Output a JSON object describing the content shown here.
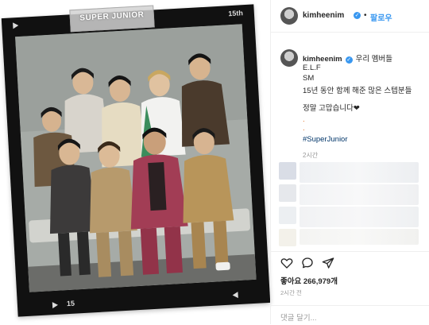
{
  "photo": {
    "tape_text": "SUPER JUNIOR",
    "frame_top": "15th",
    "frame_bottom": "15"
  },
  "header": {
    "username": "kimheenim",
    "separator": "•",
    "follow_label": "팔로우"
  },
  "caption": {
    "username": "kimheenim",
    "lines": [
      "우리 멤버들",
      "E.L.F",
      "SM",
      "15년 동안 함께 해준 많은 스텝분들",
      "정말 고맙습니다❤",
      ".",
      ".",
      "#SuperJunior"
    ],
    "time": "2시간"
  },
  "stats": {
    "likes": "좋아요 266,979개",
    "time": "2시간 전"
  },
  "comment": {
    "placeholder": "댓글 달기..."
  },
  "icons": [
    "heart-icon",
    "comment-icon",
    "share-icon",
    "verified-badge-icon"
  ],
  "colors": {
    "accent": "#3897f0",
    "hashtag": "#003569",
    "muted": "#999999"
  }
}
